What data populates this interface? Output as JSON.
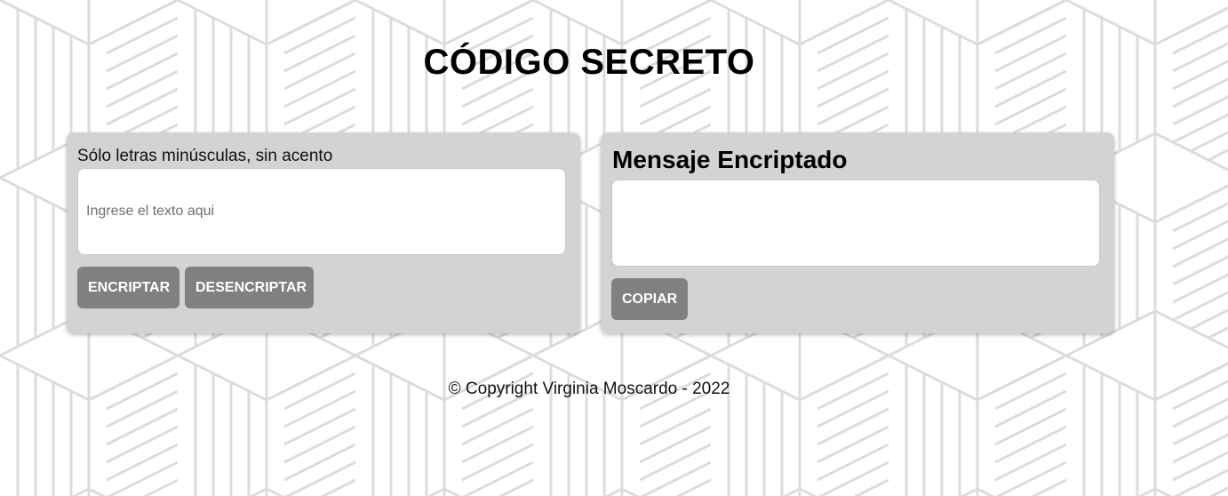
{
  "header": {
    "title": "CÓDIGO SECRETO"
  },
  "input_panel": {
    "hint": "Sólo letras minúsculas, sin acento",
    "placeholder": "Ingrese el texto aqui",
    "value": "",
    "encrypt_label": "ENCRIPTAR",
    "decrypt_label": "DESENCRIPTAR"
  },
  "output_panel": {
    "heading": "Mensaje Encriptado",
    "value": "",
    "copy_label": "COPIAR"
  },
  "footer": {
    "text": "© Copyright Virginia Moscardo - 2022"
  },
  "colors": {
    "card_background": "#d3d3d3",
    "button_background": "#808080",
    "button_text": "#ffffff",
    "pattern_lines": "#dcdcdc"
  }
}
